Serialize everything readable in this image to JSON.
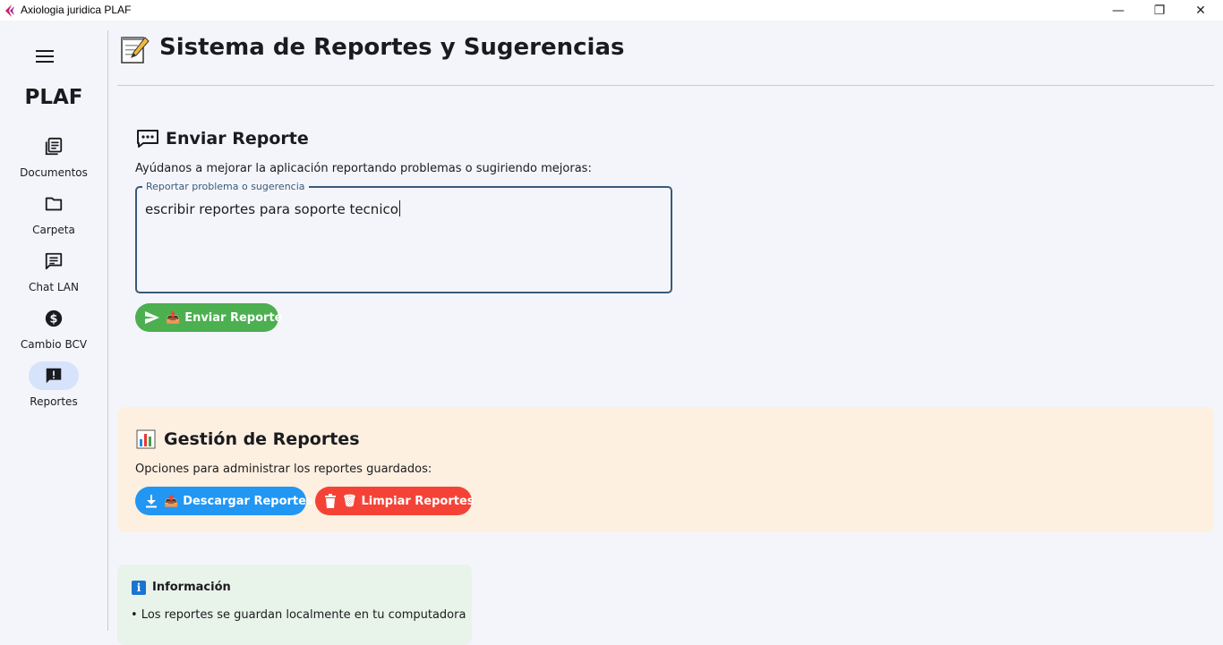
{
  "window": {
    "title": "Axiologia juridica PLAF",
    "minimize": "—",
    "maximize": "❐",
    "close": "✕"
  },
  "sidebar": {
    "brand": "PLAF",
    "items": [
      {
        "label": "Documentos",
        "icon": "documents-icon"
      },
      {
        "label": "Carpeta",
        "icon": "folder-icon"
      },
      {
        "label": "Chat LAN",
        "icon": "chat-icon"
      },
      {
        "label": "Cambio BCV",
        "icon": "dollar-icon"
      },
      {
        "label": "Reportes",
        "icon": "report-icon",
        "active": true
      }
    ]
  },
  "header": {
    "icon": "memo-icon",
    "title": "Sistema de Reportes y Sugerencias"
  },
  "send_section": {
    "title": "Enviar Reporte",
    "description": "Ayúdanos a mejorar la aplicación reportando problemas o sugiriendo mejoras:",
    "field_label": "Reportar problema o sugerencia",
    "field_value": "escribir reportes para soporte tecnico",
    "button_label": "Enviar Reporte",
    "button_color": "#4caf50"
  },
  "manage_section": {
    "title": "Gestión de Reportes",
    "description": "Opciones para administrar los reportes guardados:",
    "download_label": "Descargar Reportes",
    "download_color": "#2196f3",
    "clear_label": "Limpiar Reportes",
    "clear_color": "#f44336",
    "card_color": "#fdf0e0"
  },
  "info_section": {
    "title": "Información",
    "lines": [
      "• Los reportes se guardan localmente en tu computadora"
    ],
    "card_color": "#e8f3e9"
  }
}
